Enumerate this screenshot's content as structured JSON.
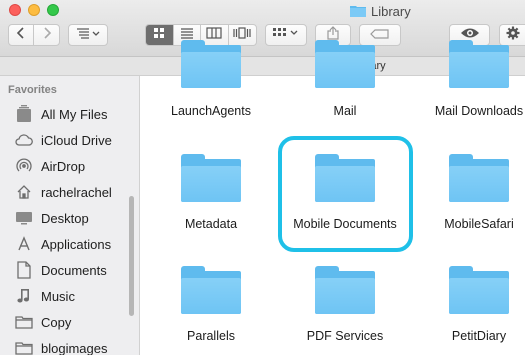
{
  "window": {
    "title": "Library",
    "traffic_lights": {
      "close": "#fc605c",
      "minimize": "#fdbc40",
      "maximize": "#34c84a"
    }
  },
  "toolbar": {
    "back_icon": "chevron-left-icon",
    "forward_icon": "chevron-right-icon",
    "arrange_icon": "arrange-menu-icon",
    "view_modes": [
      "icon-view-icon",
      "list-view-icon",
      "column-view-icon",
      "cover-flow-icon"
    ],
    "active_view": "icon-view-icon",
    "group_icon": "group-by-menu-icon",
    "share_icon": "share-icon",
    "tags_icon": "tag-icon",
    "quicklook_icon": "eye-icon",
    "action_icon": "gear-icon"
  },
  "pathbar": {
    "label": "Library"
  },
  "sidebar": {
    "heading": "Favorites",
    "items": [
      {
        "label": "All My Files",
        "icon": "all-files-icon"
      },
      {
        "label": "iCloud Drive",
        "icon": "cloud-icon"
      },
      {
        "label": "AirDrop",
        "icon": "airdrop-icon"
      },
      {
        "label": "rachelrachel",
        "icon": "home-icon"
      },
      {
        "label": "Desktop",
        "icon": "desktop-icon"
      },
      {
        "label": "Applications",
        "icon": "applications-icon"
      },
      {
        "label": "Documents",
        "icon": "documents-icon"
      },
      {
        "label": "Music",
        "icon": "music-icon"
      },
      {
        "label": "Copy",
        "icon": "folder-icon"
      },
      {
        "label": "blogimages",
        "icon": "folder-icon"
      }
    ]
  },
  "files": [
    {
      "name": "LaunchAgents",
      "selected": false
    },
    {
      "name": "Mail",
      "selected": false
    },
    {
      "name": "Mail Downloads",
      "selected": false
    },
    {
      "name": "Metadata",
      "selected": false
    },
    {
      "name": "Mobile Documents",
      "selected": true
    },
    {
      "name": "MobileSafari",
      "selected": false
    },
    {
      "name": "Parallels",
      "selected": false
    },
    {
      "name": "PDF Services",
      "selected": false
    },
    {
      "name": "PetitDiary",
      "selected": false
    }
  ],
  "colors": {
    "folder": "#6ec4f4",
    "selection": "#1fc0e8",
    "sidebar": "#eeeef0"
  }
}
